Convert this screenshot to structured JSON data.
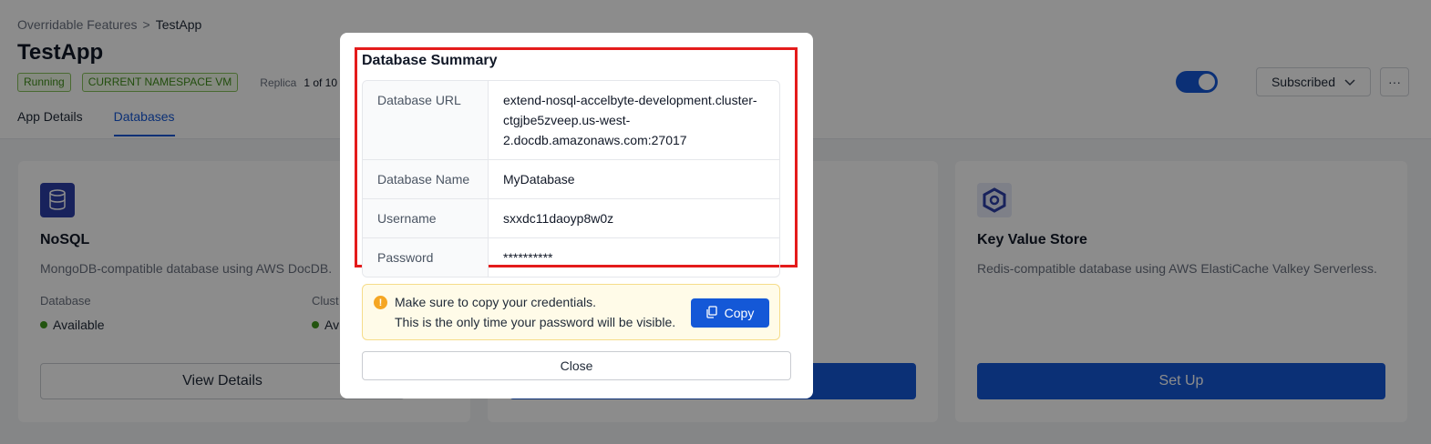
{
  "breadcrumb": {
    "parent": "Overridable Features",
    "separator": ">",
    "current": "TestApp"
  },
  "page": {
    "title": "TestApp",
    "status_badge": "Running",
    "namespace_badge": "CURRENT NAMESPACE VM",
    "replica_label": "Replica",
    "replica_value": "1 of 10"
  },
  "tabs": [
    {
      "label": "App Details",
      "active": false
    },
    {
      "label": "Databases",
      "active": true
    }
  ],
  "header_actions": {
    "toggle_on": true,
    "subscribed_label": "Subscribed",
    "more_label": "···"
  },
  "cards": {
    "nosql": {
      "icon": "database-icon",
      "title": "NoSQL",
      "description": "MongoDB-compatible database using AWS DocDB.",
      "database_label": "Database",
      "database_status": "Available",
      "cluster_label": "Clust",
      "cluster_status": "Av",
      "button": "View Details"
    },
    "kv": {
      "icon": "hexagon-icon",
      "title": "Key Value Store",
      "description": "Redis-compatible database using AWS ElastiCache Valkey Serverless.",
      "button": "Set Up"
    }
  },
  "modal": {
    "title": "Database Summary",
    "rows": [
      {
        "key": "Database URL",
        "value": "extend-nosql-accelbyte-development.cluster-ctgjbe5zveep.us-west-2.docdb.amazonaws.com:27017"
      },
      {
        "key": "Database Name",
        "value": "MyDatabase"
      },
      {
        "key": "Username",
        "value": "sxxdc11daoyp8w0z"
      },
      {
        "key": "Password",
        "value": "**********"
      }
    ],
    "notice_line1": "Make sure to copy your credentials.",
    "notice_line2": "This is the only time your password will be visible.",
    "copy_label": "Copy",
    "close_label": "Close"
  },
  "colors": {
    "primary": "#1458d7",
    "success": "#3f9a1d",
    "warning": "#f5a623",
    "highlight": "#e41b1b"
  }
}
